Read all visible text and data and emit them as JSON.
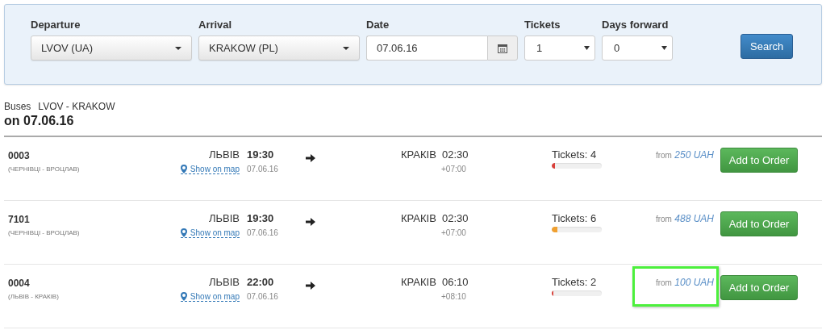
{
  "search_form": {
    "fields": [
      {
        "label": "Departure",
        "kind": "dropdown",
        "value": "LVOV (UA)"
      },
      {
        "label": "Arrival",
        "kind": "dropdown",
        "value": "KRAKOW (PL)"
      },
      {
        "label": "Date",
        "kind": "date",
        "value": "07.06.16"
      },
      {
        "label": "Tickets",
        "kind": "select",
        "value": "1"
      },
      {
        "label": "Days forward",
        "kind": "select",
        "value": "0"
      }
    ],
    "button": "Search"
  },
  "results": {
    "label": "Buses",
    "route": "LVOV - KRAKOW",
    "date_heading": "on 07.06.16",
    "trips": [
      {
        "number": "0003",
        "route": "(ЧЕРНІВЦІ - ВРОЦЛАВ)",
        "from_city": "ЛЬВІВ",
        "map_link": "Show on map",
        "departure_time": "19:30",
        "departure_date": "07.06.16",
        "to_city": "КРАКІВ",
        "arrival_time": "02:30",
        "duration": "+07:00",
        "tickets": "Tickets: 4",
        "level": 0.06,
        "color": "#d9403a",
        "price_prefix": "from",
        "price": "250 UAH",
        "highlighted": false,
        "button": "Add to Order"
      },
      {
        "number": "7101",
        "route": "(ЧЕРНІВЦІ - ВРОЦЛАВ)",
        "from_city": "ЛЬВІВ",
        "map_link": "Show on map",
        "departure_time": "19:30",
        "departure_date": "07.06.16",
        "to_city": "КРАКІВ",
        "arrival_time": "02:30",
        "duration": "+07:00",
        "tickets": "Tickets: 6",
        "level": 0.12,
        "color": "#f0a030",
        "price_prefix": "from",
        "price": "488 UAH",
        "highlighted": false,
        "button": "Add to Order"
      },
      {
        "number": "0004",
        "route": "(ЛЬВІВ - КРАКІВ)",
        "from_city": "ЛЬВІВ",
        "map_link": "Show on map",
        "departure_time": "22:00",
        "departure_date": "07.06.16",
        "to_city": "КРАКІВ",
        "arrival_time": "06:10",
        "duration": "+08:10",
        "tickets": "Tickets: 2",
        "level": 0.04,
        "color": "#d9403a",
        "price_prefix": "from",
        "price": "100 UAH",
        "highlighted": true,
        "button": "Add to Order"
      }
    ]
  }
}
